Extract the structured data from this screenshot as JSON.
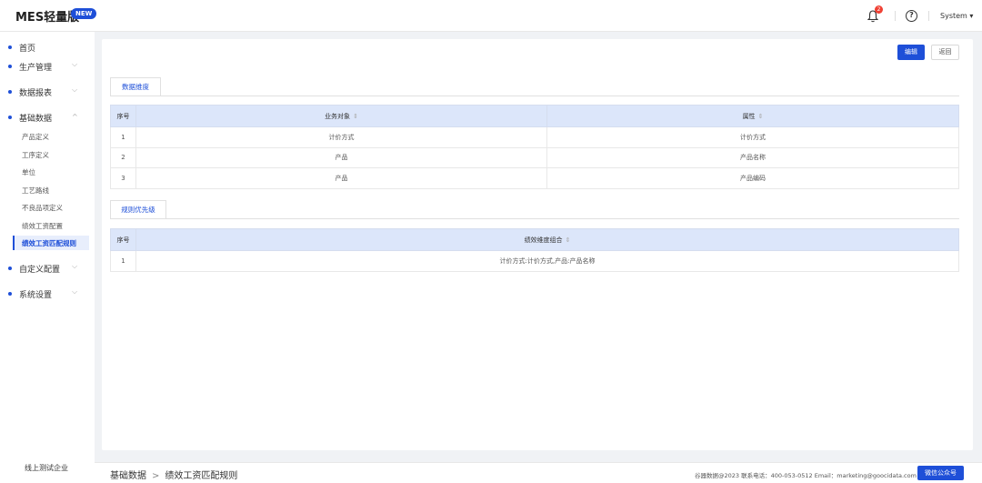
{
  "app": {
    "title": "MES轻量版",
    "badge": "NEW"
  },
  "topbar": {
    "notifications": "2",
    "help_label": "?",
    "user": "System",
    "user_caret": "▾"
  },
  "sidebar": {
    "items": [
      {
        "label": "首页",
        "chev": ""
      },
      {
        "label": "生产管理",
        "chev": "⌵"
      },
      {
        "label": "数据报表",
        "chev": "⌵"
      },
      {
        "label": "基础数据",
        "chev": "^"
      },
      {
        "label": "自定义配置",
        "chev": "⌵"
      },
      {
        "label": "系统设置",
        "chev": "⌵"
      }
    ],
    "sub_items": [
      "产品定义",
      "工序定义",
      "单位",
      "工艺路线",
      "不良品项定义",
      "绩效工资配置",
      "绩效工资匹配规则"
    ],
    "company": "线上测试企业"
  },
  "actions": {
    "edit": "编辑",
    "back": "返回"
  },
  "tabs": {
    "dimension": "数据维度",
    "priority": "规则优先级"
  },
  "table1": {
    "headers": [
      "序号",
      "业务对象",
      "属性"
    ],
    "sort_icon": "⇕",
    "rows": [
      [
        "1",
        "计价方式",
        "计价方式"
      ],
      [
        "2",
        "产品",
        "产品名称"
      ],
      [
        "3",
        "产品",
        "产品编码"
      ]
    ]
  },
  "table2": {
    "headers": [
      "序号",
      "绩效维度组合"
    ],
    "rows": [
      [
        "1",
        "计价方式:计价方式,产品:产品名称"
      ]
    ]
  },
  "footer": {
    "breadcrumb": [
      "基础数据",
      "绩效工资匹配规则"
    ],
    "breadcrumb_sep": ">",
    "copyright": "谷器数据@2023 联系电话：400-053-0512 Email：marketing@goocidata.com",
    "wechat": "微信公众号"
  },
  "colors": {
    "primary": "#1e4fd8",
    "header_bg": "#dce6fa",
    "badge_red": "#f04134"
  }
}
